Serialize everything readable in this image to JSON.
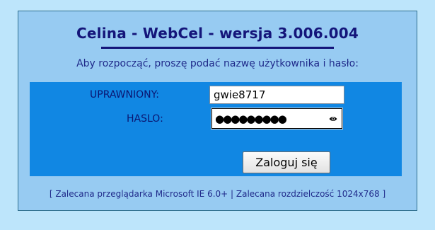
{
  "header": {
    "title": "Celina - WebCel - wersja 3.006.004",
    "subtitle": "Aby rozpocząć, proszę podać nazwę użytkownika i hasło:"
  },
  "form": {
    "username_label": "UPRAWNIONY:",
    "username_value": "gwie8717",
    "password_label": "HASLO:",
    "password_masked": "●●●●●●●●●",
    "login_label": "Zaloguj się"
  },
  "footer": {
    "note": "[ Zalecana przeglądarka Microsoft IE 6.0+ | Zalecana rozdzielczość 1024x768 ]"
  },
  "icons": {
    "reveal_password": "eye-icon"
  },
  "colors": {
    "page_background": "#bde5fb",
    "panel_background": "#97cbf2",
    "form_background": "#1187e3",
    "title_text": "#14157a"
  }
}
